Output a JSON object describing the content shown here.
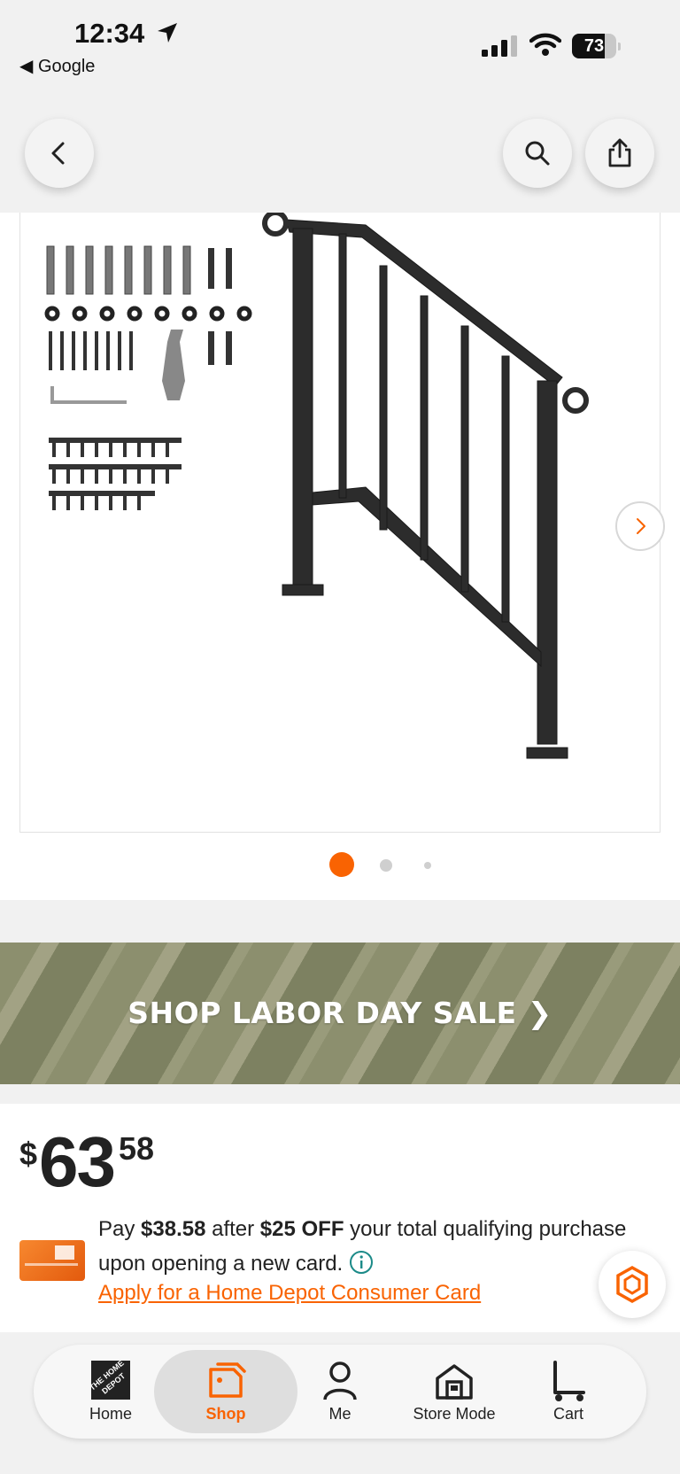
{
  "status_bar": {
    "time": "12:34",
    "back_app": "◀ Google",
    "battery": "73",
    "battery_level": 0.73
  },
  "header": {
    "back_icon": "chevron-left-icon",
    "search_icon": "search-icon",
    "share_icon": "share-icon"
  },
  "gallery": {
    "image_alt": "handrail-product-image",
    "current_index": 1,
    "image_count": 3,
    "next_icon": "chevron-right-icon"
  },
  "promo": {
    "label": "SHOP LABOR DAY SALE ❯"
  },
  "price": {
    "currency": "$",
    "dollars": "63",
    "cents": "58"
  },
  "offer": {
    "pay_prefix": "Pay ",
    "pay_amount": "$38.58",
    "after": " after ",
    "discount": "$25 OFF",
    "suffix": " your total qualifying purchase upon opening a new card.",
    "apply_link": "Apply for a Home Depot Consumer Card"
  },
  "colors": {
    "accent": "#f96302",
    "promo_bg": "#8c8f6e"
  },
  "tabbar": {
    "items": [
      {
        "label": "Home",
        "icon": "home-depot-logo-icon"
      },
      {
        "label": "Shop",
        "icon": "shop-tag-icon",
        "active": true
      },
      {
        "label": "Me",
        "icon": "person-icon"
      },
      {
        "label": "Store Mode",
        "icon": "store-icon"
      },
      {
        "label": "Cart",
        "icon": "cart-icon"
      }
    ]
  }
}
